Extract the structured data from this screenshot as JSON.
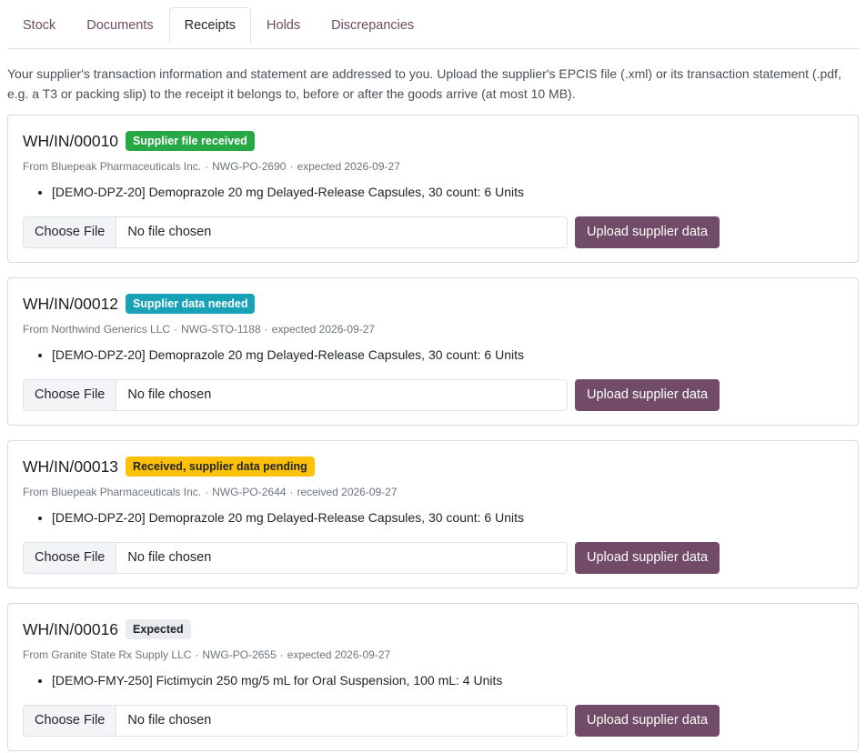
{
  "tabs": [
    {
      "label": "Stock",
      "active": false
    },
    {
      "label": "Documents",
      "active": false
    },
    {
      "label": "Receipts",
      "active": true
    },
    {
      "label": "Holds",
      "active": false
    },
    {
      "label": "Discrepancies",
      "active": false
    }
  ],
  "intro": "Your supplier's transaction information and statement are addressed to you. Upload the supplier's EPCIS file (.xml) or its transaction statement (.pdf, e.g. a T3 or packing slip) to the receipt it belongs to, before or after the goods arrive (at most 10 MB).",
  "colors": {
    "accent": "#714b67",
    "badge_green": "#28a745",
    "badge_teal": "#17a2b8",
    "badge_yellow": "#ffc107",
    "badge_light": "#e9ecef"
  },
  "receipts": [
    {
      "ref": "WH/IN/00010",
      "badge": "Supplier file received",
      "badge_style": "green",
      "supplier": "From Bluepeak Pharmaceuticals Inc.",
      "po": "NWG-PO-2690",
      "date": "expected 2026-09-27",
      "line": "[DEMO-DPZ-20] Demoprazole 20 mg Delayed-Release Capsules, 30 count: 6 Units",
      "file_button": "Choose File",
      "file_name": "No file chosen",
      "upload_label": "Upload supplier data"
    },
    {
      "ref": "WH/IN/00012",
      "badge": "Supplier data needed",
      "badge_style": "teal",
      "supplier": "From Northwind Generics LLC",
      "po": "NWG-STO-1188",
      "date": "expected 2026-09-27",
      "line": "[DEMO-DPZ-20] Demoprazole 20 mg Delayed-Release Capsules, 30 count: 6 Units",
      "file_button": "Choose File",
      "file_name": "No file chosen",
      "upload_label": "Upload supplier data"
    },
    {
      "ref": "WH/IN/00013",
      "badge": "Received, supplier data pending",
      "badge_style": "yellow",
      "supplier": "From Bluepeak Pharmaceuticals Inc.",
      "po": "NWG-PO-2644",
      "date": "received 2026-09-27",
      "line": "[DEMO-DPZ-20] Demoprazole 20 mg Delayed-Release Capsules, 30 count: 6 Units",
      "file_button": "Choose File",
      "file_name": "No file chosen",
      "upload_label": "Upload supplier data"
    },
    {
      "ref": "WH/IN/00016",
      "badge": "Expected",
      "badge_style": "light",
      "supplier": "From Granite State Rx Supply LLC",
      "po": "NWG-PO-2655",
      "date": "expected 2026-09-27",
      "line": "[DEMO-FMY-250] Fictimycin 250 mg/5 mL for Oral Suspension, 100 mL: 4 Units",
      "file_button": "Choose File",
      "file_name": "No file chosen",
      "upload_label": "Upload supplier data"
    }
  ]
}
